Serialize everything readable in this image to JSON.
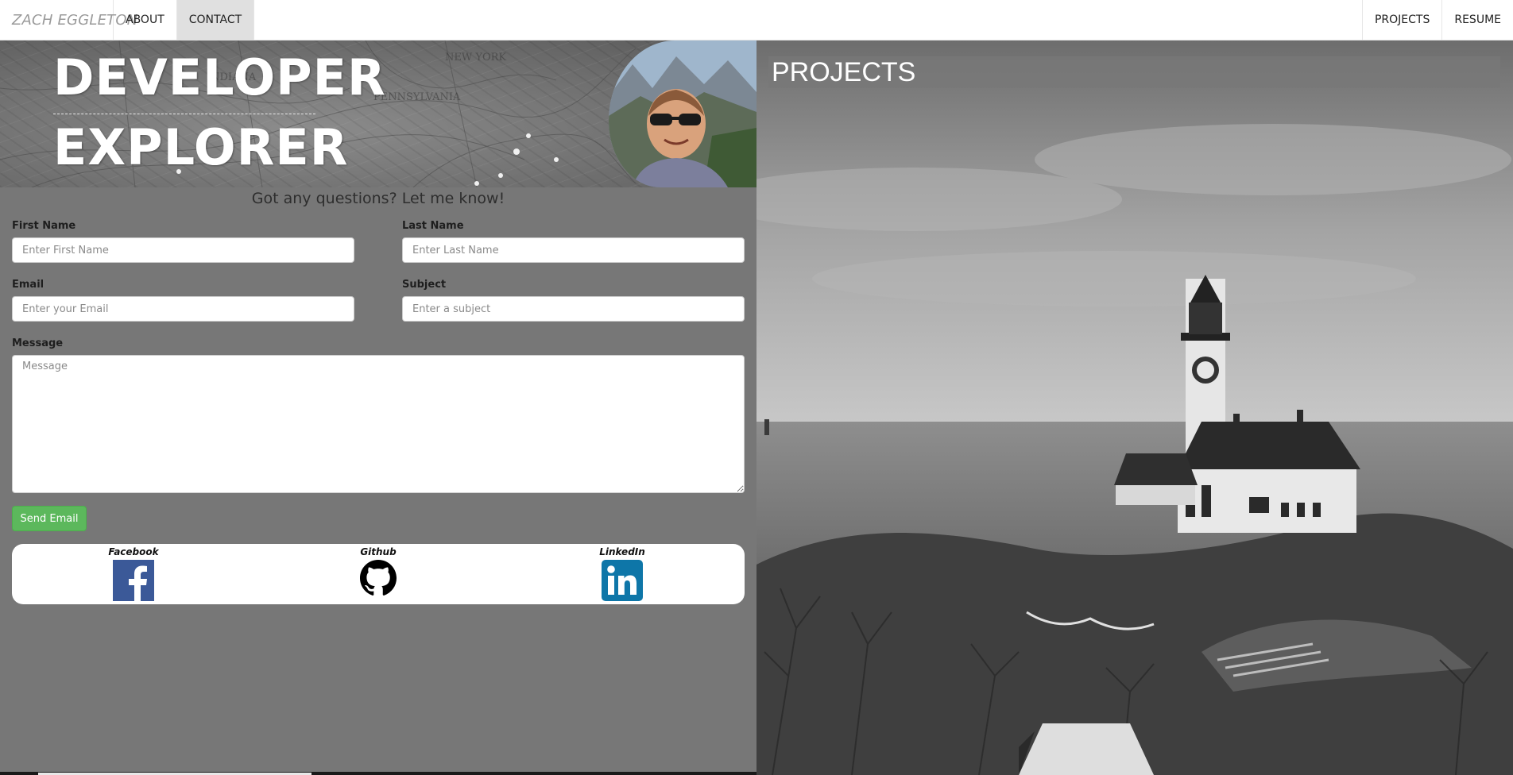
{
  "navbar": {
    "brand": "ZACH EGGLETON",
    "left_links": [
      {
        "label": "ABOUT",
        "active": false
      },
      {
        "label": "CONTACT",
        "active": true
      }
    ],
    "right_links": [
      {
        "label": "PROJECTS"
      },
      {
        "label": "RESUME"
      }
    ]
  },
  "hero": {
    "line1": "DEVELOPER",
    "line2": "EXPLORER"
  },
  "contact": {
    "subtitle": "Got any questions? Let me know!",
    "first_name": {
      "label": "First Name",
      "placeholder": "Enter First Name",
      "value": ""
    },
    "last_name": {
      "label": "Last Name",
      "placeholder": "Enter Last Name",
      "value": ""
    },
    "email": {
      "label": "Email",
      "placeholder": "Enter your Email",
      "value": ""
    },
    "subject": {
      "label": "Subject",
      "placeholder": "Enter a subject",
      "value": ""
    },
    "message": {
      "label": "Message",
      "placeholder": "Message",
      "value": ""
    },
    "send_label": "Send Email"
  },
  "social": [
    {
      "name": "Facebook",
      "icon": "facebook-icon",
      "color": "#3b5998"
    },
    {
      "name": "Github",
      "icon": "github-icon",
      "color": "#000000"
    },
    {
      "name": "LinkedIn",
      "icon": "linkedin-icon",
      "color": "#0e76a8"
    }
  ],
  "projects": {
    "title": "PROJECTS"
  },
  "colors": {
    "send_button": "#5cb85c",
    "panel_background": "#777777",
    "active_nav": "#e0e0e0"
  }
}
